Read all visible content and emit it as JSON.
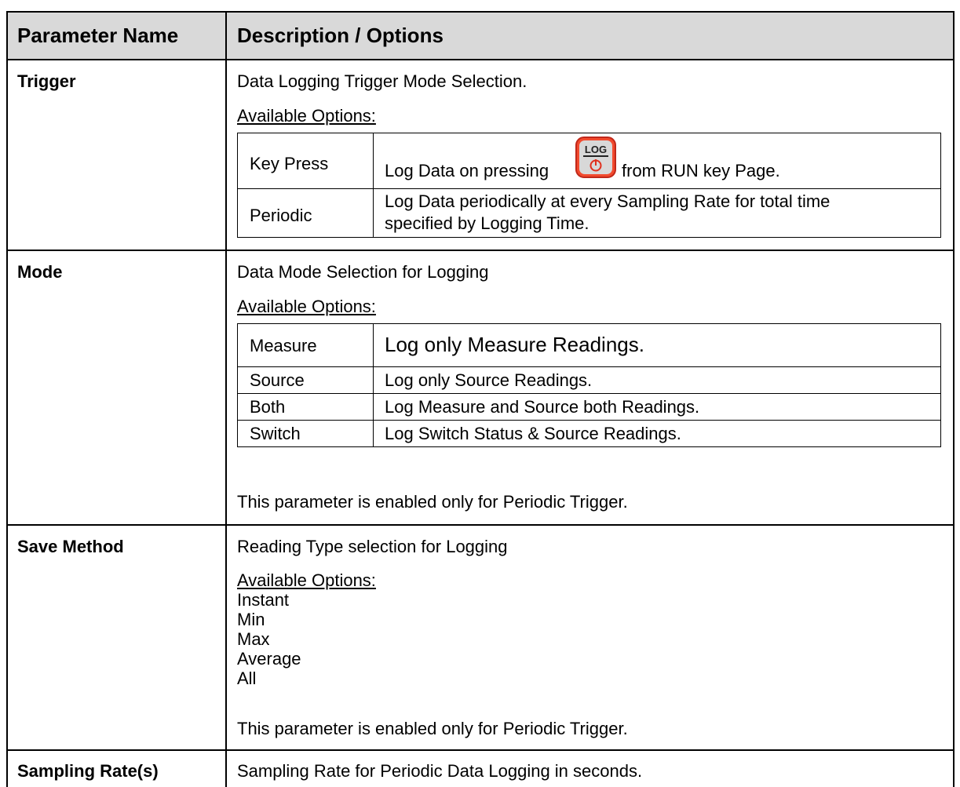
{
  "header": {
    "col1": "Parameter Name",
    "col2": "Description / Options"
  },
  "rows": {
    "trigger": {
      "name": "Trigger",
      "description": "Data Logging Trigger Mode Selection.",
      "options_label": "Available Options:",
      "options": [
        {
          "option": "Key Press",
          "desc_before": "Log Data on pressing",
          "desc_after": "from RUN key Page.",
          "key_icon": "log-key-icon",
          "key_label": "LOG"
        },
        {
          "option": "Periodic",
          "desc_line1": "Log Data periodically at every Sampling Rate for total time",
          "desc_line2": "specified by Logging Time."
        }
      ]
    },
    "mode": {
      "name": "Mode",
      "description": "Data Mode Selection for Logging",
      "options_label": "Available Options:",
      "options": [
        {
          "option": "Measure",
          "desc": "Log only Measure Readings."
        },
        {
          "option": "Source",
          "desc": "Log only Source Readings."
        },
        {
          "option": "Both",
          "desc": "Log Measure and Source both Readings."
        },
        {
          "option": "Switch",
          "desc": "Log Switch Status & Source Readings."
        }
      ],
      "note": "This parameter is enabled only for Periodic Trigger."
    },
    "save_method": {
      "name": "Save Method",
      "description": "Reading Type selection for Logging",
      "options_label": "Available Options:",
      "options": [
        "Instant",
        "Min",
        "Max",
        "Average",
        "All"
      ],
      "note": "This parameter is enabled only for Periodic Trigger."
    },
    "sampling_rate": {
      "name": "Sampling Rate(s)",
      "description": "Sampling Rate for Periodic Data Logging in seconds."
    }
  }
}
